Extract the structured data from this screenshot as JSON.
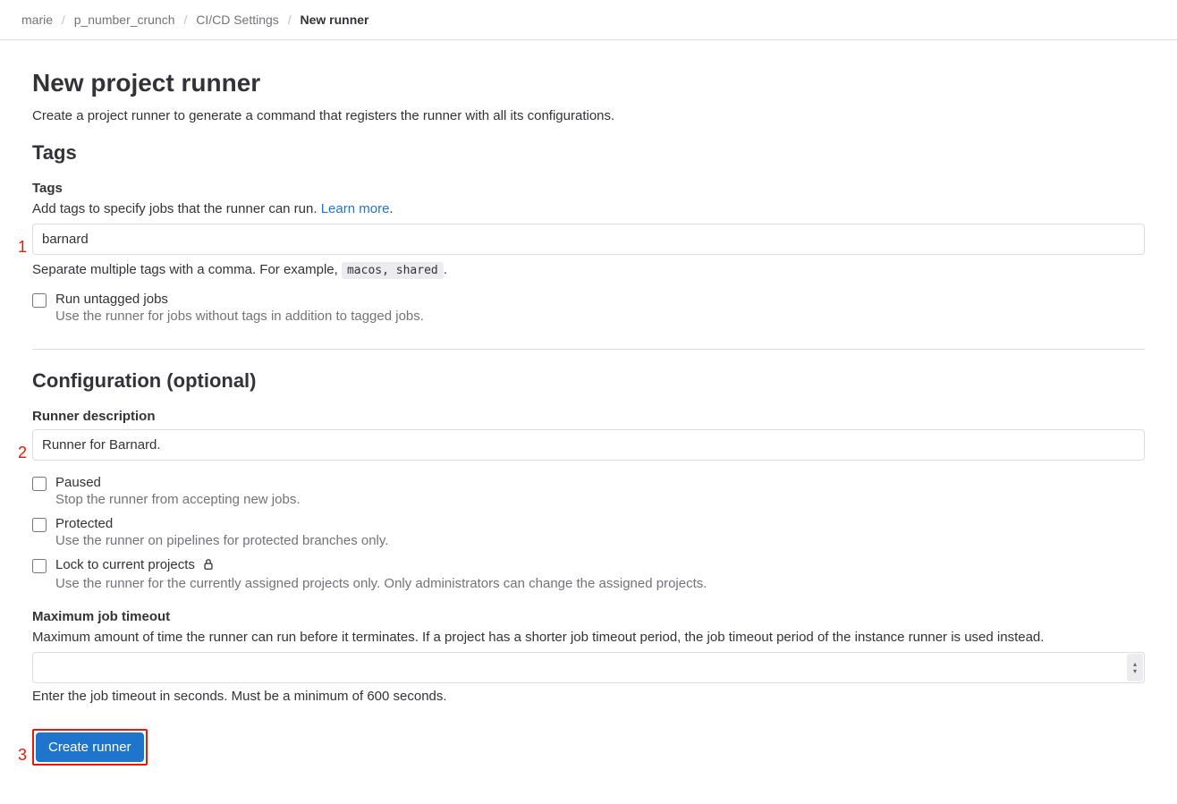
{
  "breadcrumbs": {
    "items": [
      {
        "label": "marie"
      },
      {
        "label": "p_number_crunch"
      },
      {
        "label": "CI/CD Settings"
      },
      {
        "label": "New runner"
      }
    ]
  },
  "page": {
    "title": "New project runner",
    "description": "Create a project runner to generate a command that registers the runner with all its configurations."
  },
  "tags": {
    "section_title": "Tags",
    "field_label": "Tags",
    "desc_prefix": "Add tags to specify jobs that the runner can run. ",
    "learn_more": "Learn more",
    "desc_suffix": ".",
    "input_value": "barnard",
    "help_prefix": "Separate multiple tags with a comma. For example, ",
    "help_code": "macos, shared",
    "help_suffix": ".",
    "run_untagged_label": "Run untagged jobs",
    "run_untagged_desc": "Use the runner for jobs without tags in addition to tagged jobs."
  },
  "config": {
    "section_title": "Configuration (optional)",
    "desc_label": "Runner description",
    "desc_value": "Runner for Barnard.",
    "paused_label": "Paused",
    "paused_desc": "Stop the runner from accepting new jobs.",
    "protected_label": "Protected",
    "protected_desc": "Use the runner on pipelines for protected branches only.",
    "lock_label": "Lock to current projects",
    "lock_desc": "Use the runner for the currently assigned projects only. Only administrators can change the assigned projects.",
    "timeout_label": "Maximum job timeout",
    "timeout_desc": "Maximum amount of time the runner can run before it terminates. If a project has a shorter job timeout period, the job timeout period of the instance runner is used instead.",
    "timeout_value": "",
    "timeout_help": "Enter the job timeout in seconds. Must be a minimum of 600 seconds."
  },
  "submit": {
    "label": "Create runner"
  },
  "annotations": {
    "a1": "1",
    "a2": "2",
    "a3": "3"
  }
}
